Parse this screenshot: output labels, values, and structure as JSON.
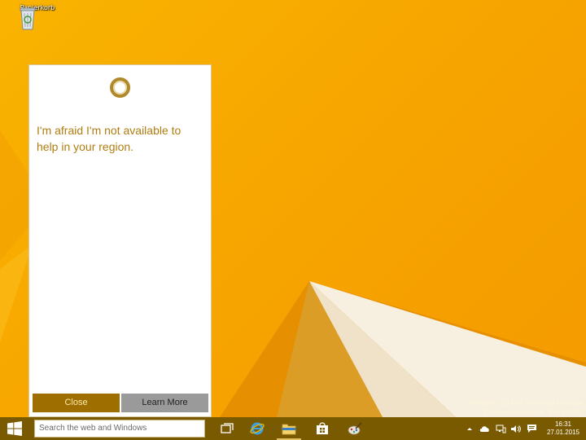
{
  "desktop": {
    "icons": [
      {
        "label": "Papierkorb",
        "icon": "recycle-bin-icon"
      }
    ]
  },
  "cortana": {
    "message": "I'm afraid I'm not available to help in your region.",
    "close_label": "Close",
    "learn_more_label": "Learn More"
  },
  "watermark": {
    "line1": "Windows 10 Pro Technical Preview",
    "line2": "Evaluierungskopie. Build 9926"
  },
  "taskbar": {
    "search_placeholder": "Search the web and Windows",
    "pinned": [
      {
        "name": "task-view",
        "icon": "task-view-icon"
      },
      {
        "name": "internet-explorer",
        "icon": "ie-icon"
      },
      {
        "name": "file-explorer",
        "icon": "folder-icon"
      },
      {
        "name": "store",
        "icon": "store-icon"
      },
      {
        "name": "paint",
        "icon": "paint-icon"
      }
    ],
    "clock": {
      "time": "16:31",
      "date": "27.01.2015"
    }
  },
  "colors": {
    "accent": "#b07d10",
    "taskbar": "#7a5a00",
    "close_button": "#9e6f00",
    "learn_more_button": "#9a9a9a"
  }
}
